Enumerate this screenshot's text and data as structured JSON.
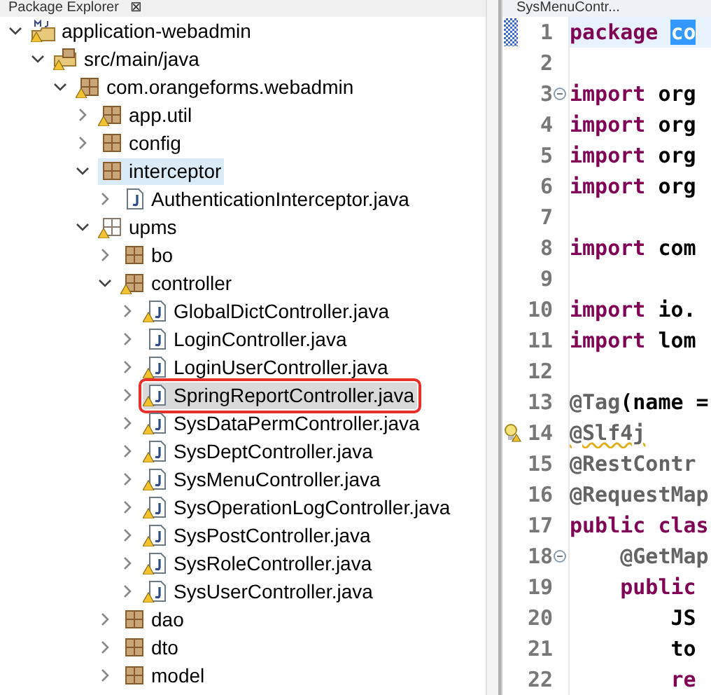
{
  "explorer": {
    "title": "Package Explorer",
    "close": "⊠",
    "tree": [
      {
        "label": "application-webadmin",
        "kind": "project",
        "warning": true,
        "expanded": true,
        "selected": false,
        "hovered": false,
        "boxed": false,
        "children": [
          {
            "label": "src/main/java",
            "kind": "source-folder",
            "warning": true,
            "expanded": true,
            "selected": false,
            "hovered": false,
            "boxed": false,
            "children": [
              {
                "label": "com.orangeforms.webadmin",
                "kind": "package",
                "warning": true,
                "expanded": true,
                "selected": false,
                "hovered": false,
                "boxed": false,
                "children": [
                  {
                    "label": "app.util",
                    "kind": "package",
                    "warning": true,
                    "expanded": false,
                    "selected": false,
                    "hovered": false,
                    "boxed": false
                  },
                  {
                    "label": "config",
                    "kind": "package",
                    "warning": false,
                    "expanded": false,
                    "selected": false,
                    "hovered": false,
                    "boxed": false
                  },
                  {
                    "label": "interceptor",
                    "kind": "package",
                    "warning": false,
                    "expanded": true,
                    "selected": false,
                    "hovered": true,
                    "boxed": false,
                    "children": [
                      {
                        "label": "AuthenticationInterceptor.java",
                        "kind": "java",
                        "warning": false,
                        "expanded": false,
                        "selected": false,
                        "hovered": false,
                        "boxed": false
                      }
                    ]
                  },
                  {
                    "label": "upms",
                    "kind": "empty-package",
                    "warning": true,
                    "expanded": true,
                    "selected": false,
                    "hovered": false,
                    "boxed": false,
                    "children": [
                      {
                        "label": "bo",
                        "kind": "package",
                        "warning": false,
                        "expanded": false,
                        "selected": false,
                        "hovered": false,
                        "boxed": false
                      },
                      {
                        "label": "controller",
                        "kind": "package",
                        "warning": true,
                        "expanded": true,
                        "selected": false,
                        "hovered": false,
                        "boxed": false,
                        "children": [
                          {
                            "label": "GlobalDictController.java",
                            "kind": "java",
                            "warning": true,
                            "expanded": false,
                            "selected": false,
                            "hovered": false,
                            "boxed": false
                          },
                          {
                            "label": "LoginController.java",
                            "kind": "java",
                            "warning": false,
                            "expanded": false,
                            "selected": false,
                            "hovered": false,
                            "boxed": false
                          },
                          {
                            "label": "LoginUserController.java",
                            "kind": "java",
                            "warning": true,
                            "expanded": false,
                            "selected": false,
                            "hovered": false,
                            "boxed": false
                          },
                          {
                            "label": "SpringReportController.java",
                            "kind": "java",
                            "warning": true,
                            "expanded": false,
                            "selected": true,
                            "hovered": false,
                            "boxed": true
                          },
                          {
                            "label": "SysDataPermController.java",
                            "kind": "java",
                            "warning": true,
                            "expanded": false,
                            "selected": false,
                            "hovered": false,
                            "boxed": false
                          },
                          {
                            "label": "SysDeptController.java",
                            "kind": "java",
                            "warning": true,
                            "expanded": false,
                            "selected": false,
                            "hovered": false,
                            "boxed": false
                          },
                          {
                            "label": "SysMenuController.java",
                            "kind": "java",
                            "warning": true,
                            "expanded": false,
                            "selected": false,
                            "hovered": false,
                            "boxed": false
                          },
                          {
                            "label": "SysOperationLogController.java",
                            "kind": "java",
                            "warning": true,
                            "expanded": false,
                            "selected": false,
                            "hovered": false,
                            "boxed": false
                          },
                          {
                            "label": "SysPostController.java",
                            "kind": "java",
                            "warning": true,
                            "expanded": false,
                            "selected": false,
                            "hovered": false,
                            "boxed": false
                          },
                          {
                            "label": "SysRoleController.java",
                            "kind": "java",
                            "warning": true,
                            "expanded": false,
                            "selected": false,
                            "hovered": false,
                            "boxed": false
                          },
                          {
                            "label": "SysUserController.java",
                            "kind": "java",
                            "warning": true,
                            "expanded": false,
                            "selected": false,
                            "hovered": false,
                            "boxed": false
                          }
                        ]
                      },
                      {
                        "label": "dao",
                        "kind": "package",
                        "warning": false,
                        "expanded": false,
                        "selected": false,
                        "hovered": false,
                        "boxed": false
                      },
                      {
                        "label": "dto",
                        "kind": "package",
                        "warning": false,
                        "expanded": false,
                        "selected": false,
                        "hovered": false,
                        "boxed": false
                      },
                      {
                        "label": "model",
                        "kind": "package",
                        "warning": false,
                        "expanded": false,
                        "selected": false,
                        "hovered": false,
                        "boxed": false
                      }
                    ]
                  }
                ]
              }
            ]
          }
        ]
      }
    ]
  },
  "editor": {
    "tab": "SysMenuContr...",
    "lines": [
      {
        "number": "1",
        "current": true,
        "fold": false,
        "warning": false,
        "tokens": [
          {
            "kind": "keyword",
            "text": "package "
          },
          {
            "kind": "selection",
            "text": "co"
          }
        ]
      },
      {
        "number": "2",
        "current": false,
        "fold": false,
        "warning": false
      },
      {
        "number": "3",
        "current": false,
        "fold": true,
        "warning": false,
        "tokens": [
          {
            "kind": "keyword",
            "text": "import "
          },
          {
            "kind": "plain",
            "text": "org"
          }
        ]
      },
      {
        "number": "4",
        "current": false,
        "fold": false,
        "warning": false,
        "tokens": [
          {
            "kind": "keyword",
            "text": "import "
          },
          {
            "kind": "plain",
            "text": "org"
          }
        ]
      },
      {
        "number": "5",
        "current": false,
        "fold": false,
        "warning": false,
        "tokens": [
          {
            "kind": "keyword",
            "text": "import "
          },
          {
            "kind": "plain",
            "text": "org"
          }
        ]
      },
      {
        "number": "6",
        "current": false,
        "fold": false,
        "warning": false,
        "tokens": [
          {
            "kind": "keyword",
            "text": "import "
          },
          {
            "kind": "plain",
            "text": "org"
          }
        ]
      },
      {
        "number": "7",
        "current": false,
        "fold": false,
        "warning": false
      },
      {
        "number": "8",
        "current": false,
        "fold": false,
        "warning": false,
        "tokens": [
          {
            "kind": "keyword",
            "text": "import "
          },
          {
            "kind": "plain",
            "text": "com"
          }
        ]
      },
      {
        "number": "9",
        "current": false,
        "fold": false,
        "warning": false
      },
      {
        "number": "10",
        "current": false,
        "fold": false,
        "warning": false,
        "tokens": [
          {
            "kind": "keyword",
            "text": "import "
          },
          {
            "kind": "plain",
            "text": "io."
          }
        ]
      },
      {
        "number": "11",
        "current": false,
        "fold": false,
        "warning": false,
        "tokens": [
          {
            "kind": "keyword",
            "text": "import "
          },
          {
            "kind": "plain",
            "text": "lom"
          }
        ]
      },
      {
        "number": "12",
        "current": false,
        "fold": false,
        "warning": false
      },
      {
        "number": "13",
        "current": false,
        "fold": false,
        "warning": false,
        "tokens": [
          {
            "kind": "annotation",
            "text": "@Tag"
          },
          {
            "kind": "plain",
            "text": "(name ="
          }
        ]
      },
      {
        "number": "14",
        "current": false,
        "fold": false,
        "warning": true,
        "tokens": [
          {
            "kind": "annotation",
            "text": "@Slf4j"
          }
        ]
      },
      {
        "number": "15",
        "current": false,
        "fold": false,
        "warning": false,
        "tokens": [
          {
            "kind": "annotation",
            "text": "@RestContr"
          }
        ]
      },
      {
        "number": "16",
        "current": false,
        "fold": false,
        "warning": false,
        "tokens": [
          {
            "kind": "annotation",
            "text": "@RequestMap"
          }
        ]
      },
      {
        "number": "17",
        "current": false,
        "fold": false,
        "warning": false,
        "tokens": [
          {
            "kind": "keyword",
            "text": "public "
          },
          {
            "kind": "keyword",
            "text": "clas"
          }
        ]
      },
      {
        "number": "18",
        "current": false,
        "fold": true,
        "warning": false,
        "tokens": [
          {
            "kind": "annotation",
            "text": "    @GetMap"
          }
        ]
      },
      {
        "number": "19",
        "current": false,
        "fold": false,
        "warning": false,
        "tokens": [
          {
            "kind": "keyword",
            "text": "    public"
          }
        ]
      },
      {
        "number": "20",
        "current": false,
        "fold": false,
        "warning": false,
        "tokens": [
          {
            "kind": "plain",
            "text": "        JS"
          }
        ]
      },
      {
        "number": "21",
        "current": false,
        "fold": false,
        "warning": false,
        "tokens": [
          {
            "kind": "plain",
            "text": "        to"
          }
        ]
      },
      {
        "number": "22",
        "current": false,
        "fold": false,
        "warning": false,
        "tokens": [
          {
            "kind": "keyword",
            "text": "        re"
          }
        ]
      }
    ]
  }
}
